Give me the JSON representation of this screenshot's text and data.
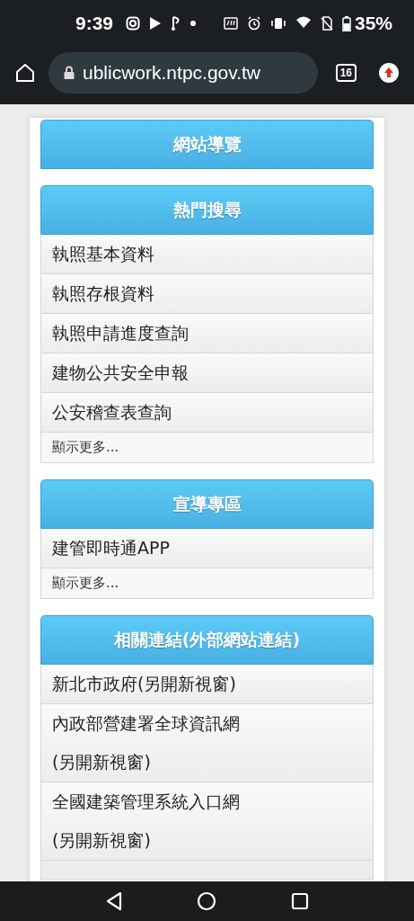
{
  "status_bar": {
    "time": "9:39",
    "battery": "35%"
  },
  "browser": {
    "url": "ublicwork.ntpc.gov.tw",
    "tab_count": "16"
  },
  "sections": [
    {
      "title": "網站導覽"
    },
    {
      "title": "熱門搜尋",
      "items": [
        {
          "kind": "link",
          "lines": [
            "執照基本資料"
          ]
        },
        {
          "kind": "link",
          "lines": [
            "執照存根資料"
          ]
        },
        {
          "kind": "link",
          "lines": [
            "執照申請進度查詢"
          ]
        },
        {
          "kind": "link",
          "lines": [
            "建物公共安全申報"
          ]
        },
        {
          "kind": "link",
          "lines": [
            "公安稽查表查詢"
          ]
        },
        {
          "kind": "more",
          "lines": [
            "顯示更多..."
          ]
        }
      ]
    },
    {
      "title": "宣導專區",
      "items": [
        {
          "kind": "link",
          "lines": [
            "建管即時通APP"
          ]
        },
        {
          "kind": "more",
          "lines": [
            "顯示更多..."
          ]
        }
      ]
    },
    {
      "title": "相關連結(外部網站連結)",
      "items": [
        {
          "kind": "link",
          "lines": [
            "新北市政府(另開新視窗)"
          ]
        },
        {
          "kind": "link",
          "lines": [
            "內政部營建署全球資訊網",
            "(另開新視窗)"
          ]
        },
        {
          "kind": "link",
          "lines": [
            "全國建築管理系統入口網",
            "(另開新視窗)"
          ]
        }
      ]
    }
  ]
}
